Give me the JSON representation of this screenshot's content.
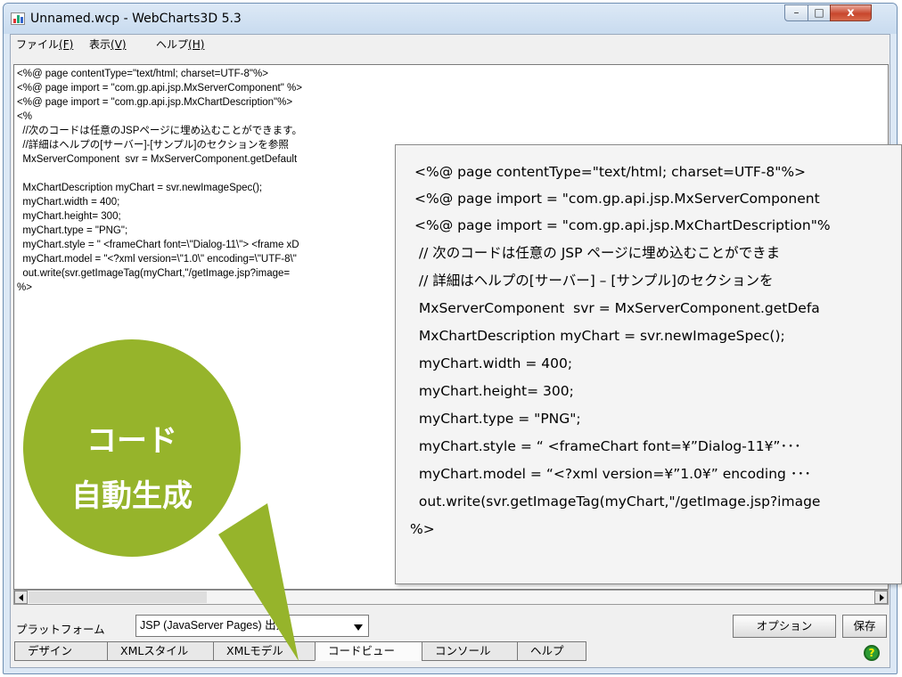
{
  "window": {
    "title": "Unnamed.wcp - WebCharts3D 5.3",
    "controls": {
      "minimize": "–",
      "maximize": "□",
      "close": "x"
    }
  },
  "menu": [
    {
      "label": "ファイル",
      "mnemonic": "(F)"
    },
    {
      "label": "表示",
      "mnemonic": "(V)"
    },
    {
      "label": "ヘルプ",
      "mnemonic": "(H)"
    }
  ],
  "editor": {
    "lines": [
      "<%@ page contentType=\"text/html; charset=UTF-8\"%>",
      "<%@ page import = \"com.gp.api.jsp.MxServerComponent\" %>",
      "<%@ page import = \"com.gp.api.jsp.MxChartDescription\"%>",
      "<%",
      "  //次のコードは任意のJSPページに埋め込むことができます。",
      "  //詳細はヘルプの[サーバー]-[サンプル]のセクションを参照",
      "  MxServerComponent  svr = MxServerComponent.getDefault",
      "",
      "  MxChartDescription myChart = svr.newImageSpec();",
      "  myChart.width = 400;",
      "  myChart.height= 300;",
      "  myChart.type = \"PNG\";",
      "  myChart.style = \" <frameChart font=\\\"Dialog-11\\\"> <frame xD",
      "  myChart.model = \"<?xml version=\\\"1.0\\\" encoding=\\\"UTF-8\\\"",
      "  out.write(svr.getImageTag(myChart,\"/getImage.jsp?image=",
      "%>"
    ]
  },
  "callout": {
    "lines": [
      "<%@ page contentType=\"text/html; charset=UTF-8\"%>",
      "<%@ page import = \"com.gp.api.jsp.MxServerComponent",
      "<%@ page import = \"com.gp.api.jsp.MxChartDescription\"%",
      " // 次のコードは任意の JSP ページに埋め込むことができま",
      " // 詳細はヘルプの[サーバー] – [サンプル]のセクションを",
      " MxServerComponent  svr = MxServerComponent.getDefa",
      " MxChartDescription myChart = svr.newImageSpec();",
      " myChart.width = 400;",
      " myChart.height= 300;",
      " myChart.type = \"PNG\";",
      " myChart.style = “ <frameChart font=¥”Dialog-11¥”･･･",
      " myChart.model = “<?xml version=¥”1.0¥” encoding ･･･",
      " out.write(svr.getImageTag(myChart,\"/getImage.jsp?image",
      "%>"
    ]
  },
  "bubble": {
    "line1": "コード",
    "line2": "自動生成",
    "color": "#96b42b"
  },
  "platform": {
    "label": "プラットフォーム",
    "value": "JSP (JavaServer Pages) 出力"
  },
  "buttons": {
    "options": "オプション",
    "save": "保存"
  },
  "tabs": [
    "デザイン",
    "XMLスタイル",
    "XMLモデル",
    "コードビュー",
    "コンソール",
    "ヘルプ"
  ],
  "active_tab": "コードビュー",
  "help_icon": "help-icon"
}
